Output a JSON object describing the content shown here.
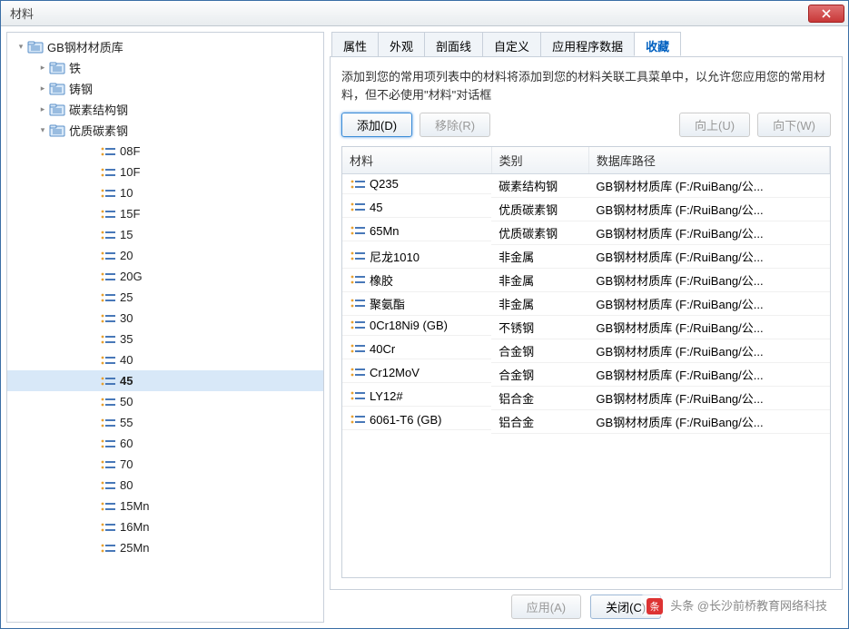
{
  "window": {
    "title": "材料"
  },
  "tree": {
    "root": {
      "label": "GB钢材材质库"
    },
    "folders": [
      {
        "label": "铁",
        "expanded": false
      },
      {
        "label": "铸钢",
        "expanded": false
      },
      {
        "label": "碳素结构钢",
        "expanded": false
      },
      {
        "label": "优质碳素钢",
        "expanded": true
      }
    ],
    "leaves": [
      {
        "label": "08F"
      },
      {
        "label": "10F"
      },
      {
        "label": "10"
      },
      {
        "label": "15F"
      },
      {
        "label": "15"
      },
      {
        "label": "20"
      },
      {
        "label": "20G"
      },
      {
        "label": "25"
      },
      {
        "label": "30"
      },
      {
        "label": "35"
      },
      {
        "label": "40"
      },
      {
        "label": "45",
        "selected": true
      },
      {
        "label": "50"
      },
      {
        "label": "55"
      },
      {
        "label": "60"
      },
      {
        "label": "70"
      },
      {
        "label": "80"
      },
      {
        "label": "15Mn"
      },
      {
        "label": "16Mn"
      },
      {
        "label": "25Mn"
      }
    ]
  },
  "tabs": [
    {
      "label": "属性"
    },
    {
      "label": "外观"
    },
    {
      "label": "剖面线"
    },
    {
      "label": "自定义"
    },
    {
      "label": "应用程序数据"
    },
    {
      "label": "收藏",
      "active": true
    }
  ],
  "fav": {
    "description": "添加到您的常用项列表中的材料将添加到您的材料关联工具菜单中，以允许您应用您的常用材料，但不必使用\"材料\"对话框",
    "add_label": "添加(D)",
    "remove_label": "移除(R)",
    "up_label": "向上(U)",
    "down_label": "向下(W)",
    "columns": {
      "material": "材料",
      "category": "类别",
      "path": "数据库路径"
    },
    "rows": [
      {
        "material": "Q235",
        "category": "碳素结构钢",
        "path": "GB钢材材质库  (F:/RuiBang/公..."
      },
      {
        "material": "45",
        "category": "优质碳素钢",
        "path": "GB钢材材质库  (F:/RuiBang/公..."
      },
      {
        "material": "65Mn",
        "category": "优质碳素钢",
        "path": "GB钢材材质库  (F:/RuiBang/公..."
      },
      {
        "material": "尼龙1010",
        "category": "非金属",
        "path": "GB钢材材质库  (F:/RuiBang/公..."
      },
      {
        "material": "橡胶",
        "category": "非金属",
        "path": "GB钢材材质库  (F:/RuiBang/公..."
      },
      {
        "material": "聚氨酯",
        "category": "非金属",
        "path": "GB钢材材质库  (F:/RuiBang/公..."
      },
      {
        "material": "0Cr18Ni9 (GB)",
        "category": "不锈钢",
        "path": "GB钢材材质库  (F:/RuiBang/公..."
      },
      {
        "material": "40Cr",
        "category": "合金钢",
        "path": "GB钢材材质库  (F:/RuiBang/公..."
      },
      {
        "material": "Cr12MoV",
        "category": "合金钢",
        "path": "GB钢材材质库  (F:/RuiBang/公..."
      },
      {
        "material": "LY12#",
        "category": "铝合金",
        "path": "GB钢材材质库  (F:/RuiBang/公..."
      },
      {
        "material": "6061-T6 (GB)",
        "category": "铝合金",
        "path": "GB钢材材质库  (F:/RuiBang/公..."
      }
    ]
  },
  "footer": {
    "apply": "应用(A)",
    "close": "关闭(C)"
  },
  "watermark": "头条 @长沙前桥教育网络科技"
}
